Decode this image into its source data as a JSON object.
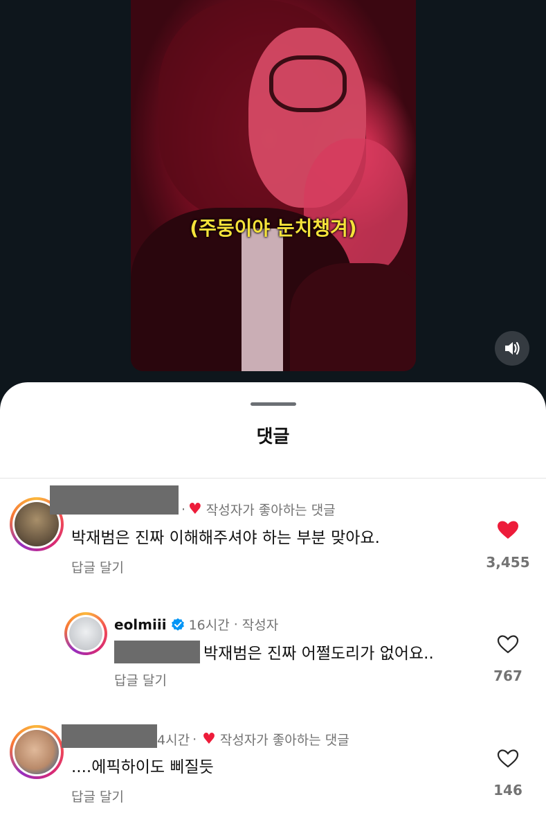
{
  "video": {
    "caption": "(주둥이야 눈치챙겨)",
    "sound_icon": "speaker-icon"
  },
  "sheet": {
    "title": "댓글"
  },
  "comments": [
    {
      "meta_suffix": "작성자가 좋아하는 댓글",
      "text": "박재범은 진짜 이해해주셔야 하는 부분 맞아요.",
      "reply_label": "답글 달기",
      "likes": "3,455",
      "liked": true
    },
    {
      "username": "eolmiii",
      "time": "16시간",
      "role": "작성자",
      "text": "박재범은 진짜 어쩔도리가 없어요..",
      "reply_label": "답글 달기",
      "likes": "767",
      "liked": false
    },
    {
      "time": "4시간",
      "meta_suffix": "작성자가 좋아하는 댓글",
      "text": "....에픽하이도 삐질듯",
      "reply_label": "답글 달기",
      "likes": "146",
      "liked": false
    }
  ],
  "colors": {
    "heart": "#ed1c3a",
    "verified": "#0095f6",
    "muted_text": "#737373"
  }
}
